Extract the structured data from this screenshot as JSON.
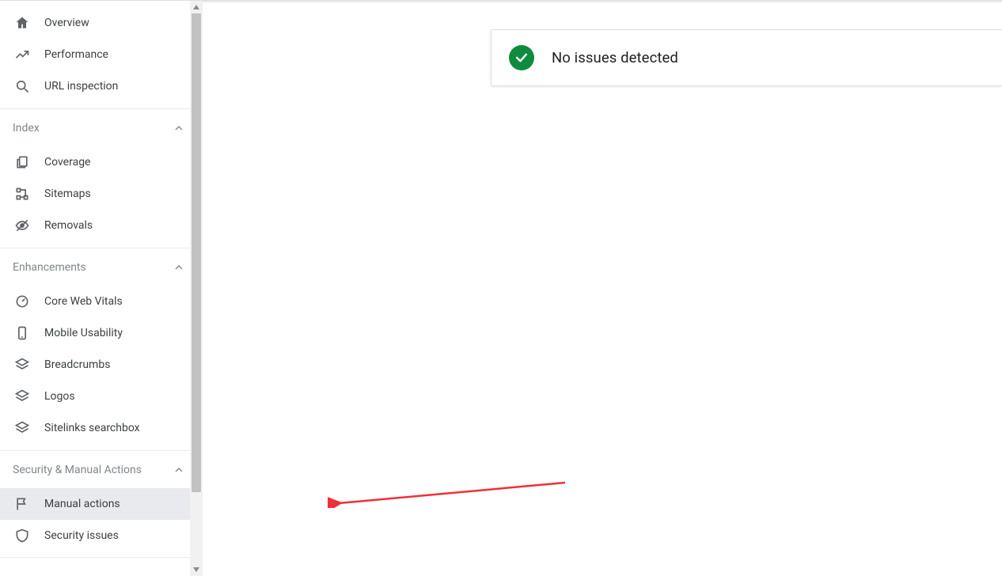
{
  "sidebar": {
    "primaryItems": [
      {
        "label": "Overview"
      },
      {
        "label": "Performance"
      },
      {
        "label": "URL inspection"
      }
    ],
    "groups": [
      {
        "header": "Index",
        "items": [
          {
            "label": "Coverage"
          },
          {
            "label": "Sitemaps"
          },
          {
            "label": "Removals"
          }
        ]
      },
      {
        "header": "Enhancements",
        "items": [
          {
            "label": "Core Web Vitals"
          },
          {
            "label": "Mobile Usability"
          },
          {
            "label": "Breadcrumbs"
          },
          {
            "label": "Logos"
          },
          {
            "label": "Sitelinks searchbox"
          }
        ]
      },
      {
        "header": "Security & Manual Actions",
        "items": [
          {
            "label": "Manual actions"
          },
          {
            "label": "Security issues"
          }
        ]
      }
    ]
  },
  "main": {
    "statusMessage": "No issues detected"
  },
  "colors": {
    "successGreen": "#0f8b3f",
    "annotationRed": "#ef3038"
  }
}
